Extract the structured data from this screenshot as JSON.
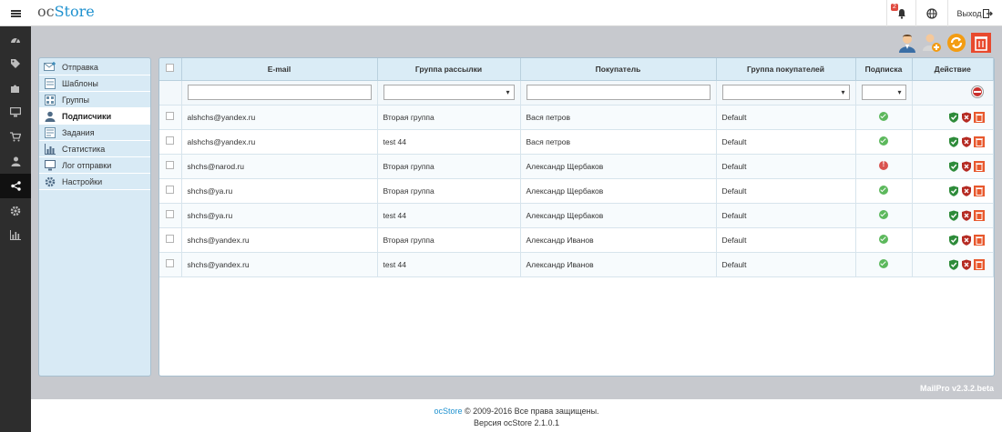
{
  "app": {
    "logo_part1": "oc",
    "logo_part2": "Store"
  },
  "topbar": {
    "notifications_badge": "2",
    "logout_label": "Выход"
  },
  "sidebar_nav": [
    "dashboard-icon",
    "tag-icon",
    "puzzle-icon",
    "desktop-icon",
    "cart-icon",
    "user-icon",
    "share-icon",
    "cog-icon",
    "bar-chart-icon"
  ],
  "page_actions": [
    "add-subscriber-icon",
    "add-user-icon",
    "refresh-icon",
    "delete-icon"
  ],
  "left_menu": [
    {
      "label": "Отправка",
      "icon": "send-mail-icon"
    },
    {
      "label": "Шаблоны",
      "icon": "template-icon"
    },
    {
      "label": "Группы",
      "icon": "group-icon"
    },
    {
      "label": "Подписчики",
      "icon": "subscriber-icon",
      "active": true
    },
    {
      "label": "Задания",
      "icon": "task-icon"
    },
    {
      "label": "Статистика",
      "icon": "chart-icon"
    },
    {
      "label": "Лог отправки",
      "icon": "monitor-icon"
    },
    {
      "label": "Настройки",
      "icon": "settings-icon"
    }
  ],
  "table": {
    "headers": {
      "email": "E-mail",
      "group": "Группа рассылки",
      "customer": "Покупатель",
      "customer_group": "Группа покупателей",
      "subscription": "Подписка",
      "action": "Действие"
    },
    "rows": [
      {
        "email": "alshchs@yandex.ru",
        "group": "Вторая группа",
        "customer": "Вася петров",
        "customer_group": "Default",
        "status": "ok"
      },
      {
        "email": "alshchs@yandex.ru",
        "group": "test 44",
        "customer": "Вася петров",
        "customer_group": "Default",
        "status": "ok"
      },
      {
        "email": "shchs@narod.ru",
        "group": "Вторая группа",
        "customer": "Александр Щербаков",
        "customer_group": "Default",
        "status": "error"
      },
      {
        "email": "shchs@ya.ru",
        "group": "Вторая группа",
        "customer": "Александр Щербаков",
        "customer_group": "Default",
        "status": "ok"
      },
      {
        "email": "shchs@ya.ru",
        "group": "test 44",
        "customer": "Александр Щербаков",
        "customer_group": "Default",
        "status": "ok"
      },
      {
        "email": "shchs@yandex.ru",
        "group": "Вторая группа",
        "customer": "Александр Иванов",
        "customer_group": "Default",
        "status": "ok"
      },
      {
        "email": "shchs@yandex.ru",
        "group": "test 44",
        "customer": "Александр Иванов",
        "customer_group": "Default",
        "status": "ok"
      }
    ]
  },
  "version_badge": "MailPro v2.3.2.beta",
  "footer": {
    "brand": "ocStore",
    "copyright": " © 2009-2016 Все права защищены.",
    "version": "Версия ocStore 2.1.0.1"
  },
  "colors": {
    "accent": "#1e91cf",
    "sidebar": "#2d2d2d",
    "header_bg": "#daecf6",
    "ok": "#5cb85c",
    "error": "#d9534f"
  }
}
